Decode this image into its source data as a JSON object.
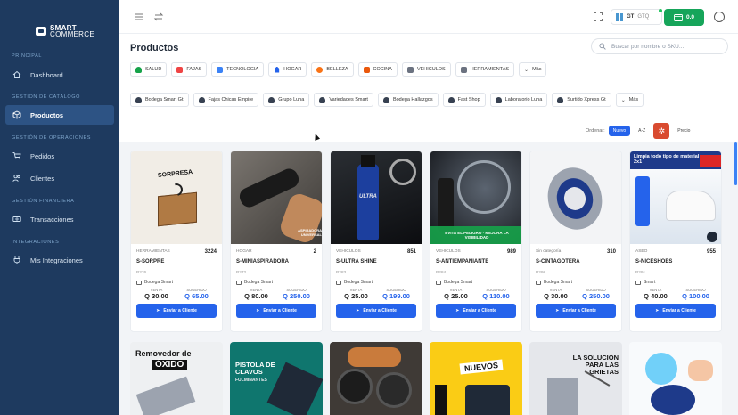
{
  "brand": {
    "line1": "SMART",
    "line2": "COMMERCE"
  },
  "sidebar": {
    "sections": [
      "PRINCIPAL",
      "GESTIÓN DE CATÁLOGO",
      "GESTIÓN DE OPERACIONES",
      "GESTIÓN FINANCIERA",
      "INTEGRACIONES"
    ],
    "items": [
      {
        "label": "Dashboard",
        "icon": "home-icon"
      },
      {
        "label": "Productos",
        "icon": "cube-icon"
      },
      {
        "label": "Pedidos",
        "icon": "cart-icon"
      },
      {
        "label": "Clientes",
        "icon": "users-icon"
      },
      {
        "label": "Transacciones",
        "icon": "money-icon"
      },
      {
        "label": "Mis Integraciones",
        "icon": "plug-icon"
      }
    ]
  },
  "topbar": {
    "country": "GT",
    "currency": "GTQ",
    "cart_total": "0.0"
  },
  "page": {
    "title": "Productos",
    "search_placeholder": "Buscar por nombre o SKU..."
  },
  "categories": [
    {
      "label": "SALUD",
      "color": "#16a34a"
    },
    {
      "label": "FAJAS",
      "color": "#ef4444"
    },
    {
      "label": "TECNOLOGIA",
      "color": "#3b82f6"
    },
    {
      "label": "HOGAR",
      "color": "#2563eb"
    },
    {
      "label": "BELLEZA",
      "color": "#f97316"
    },
    {
      "label": "COCINA",
      "color": "#ea580c"
    },
    {
      "label": "VEHICULOS",
      "color": "#6b7280"
    },
    {
      "label": "HERRAMIENTAS",
      "color": "#6b7280"
    },
    {
      "label": "Más",
      "color": ""
    }
  ],
  "suppliers": [
    "Bodega Smart Gt",
    "Fajas Chicas Empire",
    "Grupo Luna",
    "Variedades Smart",
    "Bodega Hallazgos",
    "Fast Shop",
    "Laboratorio Luna",
    "Surtido Xpress Gt",
    "Más"
  ],
  "sort": {
    "label": "Ordenar:",
    "options": [
      "Nuevo",
      "A-Z",
      "Precio"
    ]
  },
  "labels": {
    "venta": "VENTA",
    "sugerido": "SUGERIDO",
    "send": "Enviar a Cliente"
  },
  "products": [
    {
      "category": "HERRAMIENTAS",
      "stock": "3224",
      "name": "S-SORPRE",
      "sku": "P276",
      "supplier": "Bodega Smart",
      "price": "Q 30.00",
      "suggested": "Q 65.00",
      "img_text": "SORPRESA"
    },
    {
      "category": "HOGAR",
      "stock": "2",
      "name": "S-MINIASPIRADORA",
      "sku": "P272",
      "supplier": "Bodega Smart",
      "price": "Q 80.00",
      "suggested": "Q 250.00",
      "img_text": "ASPIRADORA UNIVERSAL"
    },
    {
      "category": "VEHICULOS",
      "stock": "851",
      "name": "S-ULTRA SHINE",
      "sku": "P283",
      "supplier": "Bodega Smart",
      "price": "Q 25.00",
      "suggested": "Q 199.00",
      "img_text": "ULTRA"
    },
    {
      "category": "VEHICULOS",
      "stock": "989",
      "name": "S-ANTIEMPANIANTE",
      "sku": "P284",
      "supplier": "Bodega Smart",
      "price": "Q 25.00",
      "suggested": "Q 110.00",
      "img_text": "EVITA EL PELIGRO · MEJORA LA VISIBILIDAD"
    },
    {
      "category": "Sin categoría",
      "stock": "310",
      "name": "S-CINTAGOTERA",
      "sku": "P298",
      "supplier": "Bodega Smart",
      "price": "Q 30.00",
      "suggested": "Q 250.00",
      "img_text": ""
    },
    {
      "category": "ASEO",
      "stock": "955",
      "name": "S-NICESHOES",
      "sku": "P291",
      "supplier": "Smart",
      "price": "Q 40.00",
      "suggested": "Q 100.00",
      "img_text": "Limpia todo tipo de material · 2x1"
    }
  ],
  "row2": [
    {
      "title": "Removedor de",
      "sub": "ÓXIDO"
    },
    {
      "title": "PISTOLA DE CLAVOS",
      "sub": "FULMINANTES"
    },
    {
      "title": "",
      "sub": ""
    },
    {
      "title": "NUEVOS",
      "sub": ""
    },
    {
      "title": "LA SOLUCIÓN PARA LAS GRIETAS",
      "sub": ""
    },
    {
      "title": "",
      "sub": ""
    }
  ]
}
